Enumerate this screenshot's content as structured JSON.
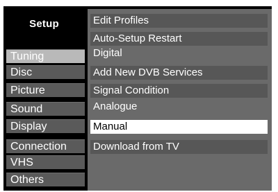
{
  "setup": {
    "title": "Setup"
  },
  "categories": [
    {
      "label": "Tuning",
      "active": true
    },
    {
      "label": "Disc",
      "active": false
    },
    {
      "label": "Picture",
      "active": false
    },
    {
      "label": "Sound",
      "active": false
    },
    {
      "label": "Display",
      "active": false
    },
    {
      "label": "Connection",
      "active": false
    },
    {
      "label": "VHS",
      "active": false
    },
    {
      "label": "Others",
      "active": false
    }
  ],
  "options": [
    {
      "label": "Edit Profiles",
      "style": "box"
    },
    {
      "label": "Auto-Setup Restart",
      "style": "box"
    },
    {
      "label": "Digital",
      "style": "heading"
    },
    {
      "label": "Add New DVB Services",
      "style": "box"
    },
    {
      "label": "Signal Condition",
      "style": "box"
    },
    {
      "label": "Analogue",
      "style": "heading"
    },
    {
      "label": "Manual",
      "style": "selected"
    },
    {
      "label": "Download from TV",
      "style": "box"
    }
  ],
  "colors": {
    "background": "#000000",
    "category_inactive": "#5a5a5a",
    "category_active": "#b9b9b9",
    "option_panel": "#6a6a6a",
    "option_item": "#575757",
    "selected_item": "#ffffff"
  }
}
